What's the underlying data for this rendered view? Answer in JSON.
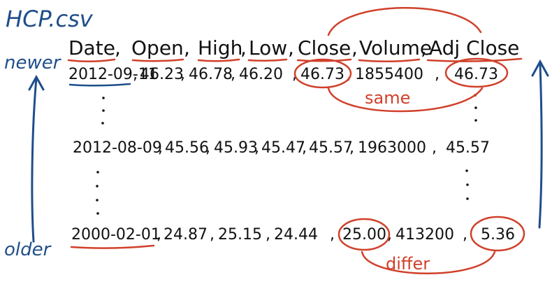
{
  "filename": "HCP.csv",
  "labels": {
    "newer": "newer",
    "older": "older",
    "same": "same",
    "differ": "differ"
  },
  "header": [
    "Date",
    "Open",
    "High",
    "Low",
    "Close",
    "Volume",
    "Adj Close"
  ],
  "rows": [
    {
      "cells": [
        "2012-09-11",
        "46.23",
        "46.78",
        "46.20",
        "46.73",
        "1855400",
        "46.73"
      ]
    },
    {
      "cells": [
        "2012-08-09",
        "45.56",
        "45.93",
        "45.47",
        "45.57",
        "1963000",
        "45.57"
      ]
    },
    {
      "cells": [
        "2000-02-01",
        "24.87",
        "25.15",
        "24.44",
        "25.00",
        "413200",
        "5.36"
      ]
    }
  ],
  "colors": {
    "ink": "#111111",
    "blue": "#1f4e8a",
    "red": "#d0402a"
  }
}
